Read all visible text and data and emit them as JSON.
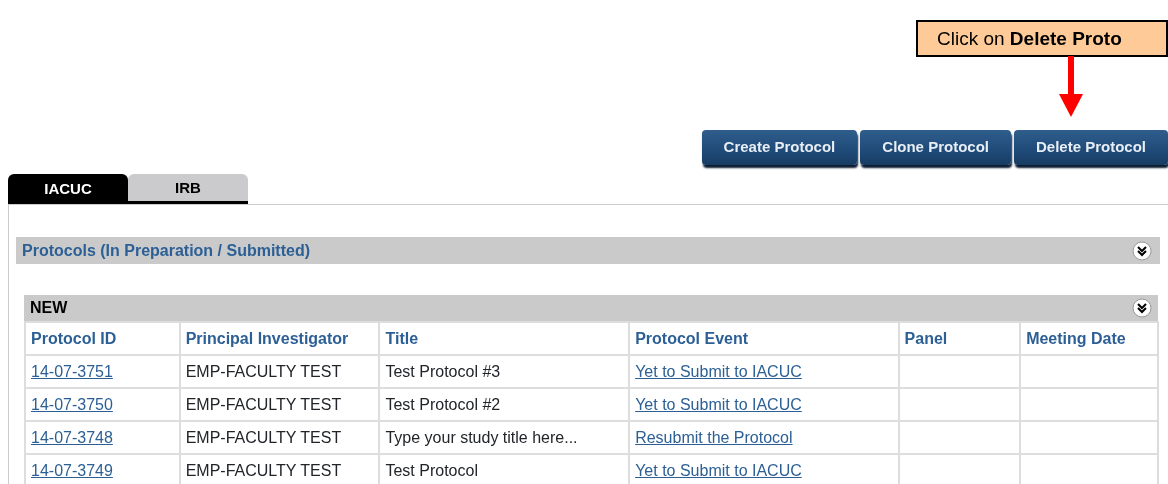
{
  "callout": {
    "text": "Click on **Delete Proto**"
  },
  "toolbar": {
    "buttons": [
      "Create Protocol",
      "Clone Protocol",
      "Delete Protocol"
    ]
  },
  "tabs": [
    {
      "label": "IACUC",
      "selected": true
    },
    {
      "label": "IRB",
      "selected": false
    }
  ],
  "section": {
    "title": "Protocols (In Preparation / Submitted)",
    "expanded": true
  },
  "group": {
    "title": "NEW",
    "expanded": true
  },
  "table": {
    "columns": [
      "Protocol ID",
      "Principal Investigator",
      "Title",
      "Protocol Event",
      "Panel",
      "Meeting Date"
    ],
    "rows": [
      {
        "id": "14-07-3751",
        "investigator": "EMP-FACULTY TEST",
        "title": "Test Protocol #3",
        "event": "Yet to Submit to IACUC"
      },
      {
        "id": "14-07-3750",
        "investigator": "EMP-FACULTY TEST",
        "title": "Test Protocol #2",
        "event": "Yet to Submit to IACUC"
      },
      {
        "id": "14-07-3748",
        "investigator": "EMP-FACULTY TEST",
        "title": "Type your study title here...",
        "event": "Resubmit the Protocol"
      },
      {
        "id": "14-07-3749",
        "investigator": "EMP-FACULTY TEST",
        "title": "Test Protocol",
        "event": "Yet to Submit to IACUC"
      }
    ]
  }
}
